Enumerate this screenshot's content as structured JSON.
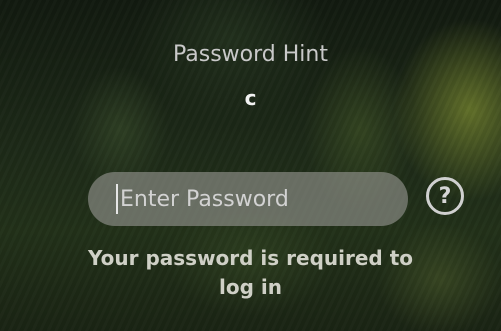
{
  "login": {
    "hint_label": "Password Hint",
    "hint_value": "c",
    "password_placeholder": "Enter Password",
    "help_glyph": "?",
    "required_line1": "Your password is required to",
    "required_line2": "log in"
  },
  "icons": {
    "help": "question-circle-icon"
  }
}
